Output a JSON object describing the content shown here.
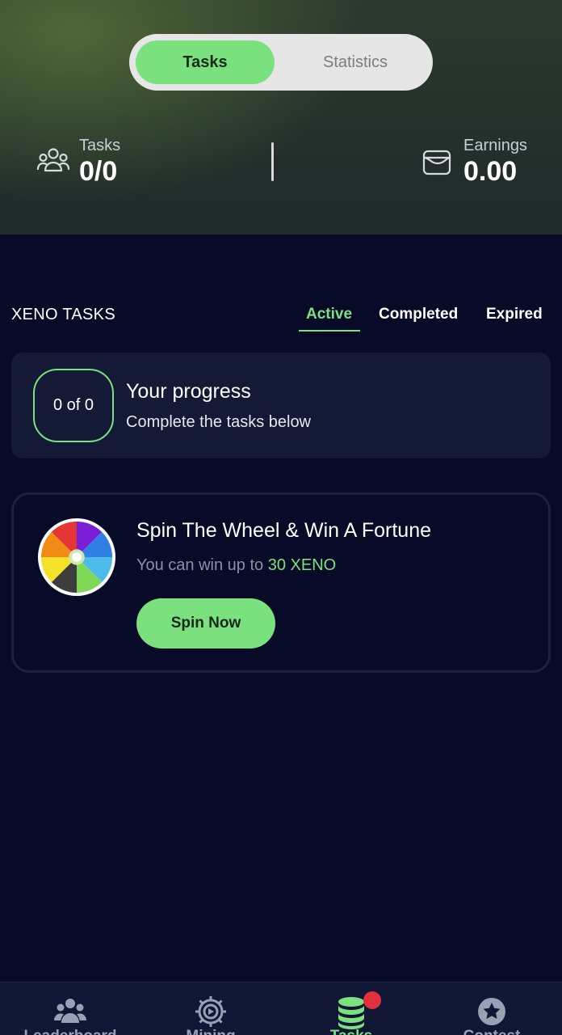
{
  "top_toggle": {
    "tasks_label": "Tasks",
    "statistics_label": "Statistics"
  },
  "stats": {
    "tasks": {
      "label": "Tasks",
      "value": "0/0",
      "icon": "users-group-icon"
    },
    "earnings": {
      "label": "Earnings",
      "value": "0.00",
      "icon": "wallet-icon"
    }
  },
  "tasks_section": {
    "title": "XENO TASKS",
    "filters": [
      "Active",
      "Completed",
      "Expired"
    ],
    "active_filter": "Active"
  },
  "progress": {
    "badge": "0 of 0",
    "title": "Your progress",
    "subtitle": "Complete the tasks below"
  },
  "spin_card": {
    "title": "Spin The Wheel & Win A Fortune",
    "subtitle_prefix": "You can win up to ",
    "subtitle_amount": "30 XENO",
    "button_label": "Spin Now",
    "icon": "prize-wheel-icon"
  },
  "bottom_nav": {
    "items": [
      {
        "label": "Leaderboard",
        "icon": "users-icon"
      },
      {
        "label": "Mining",
        "icon": "gear-play-icon"
      },
      {
        "label": "Tasks",
        "icon": "coin-stack-icon"
      },
      {
        "label": "Contest",
        "icon": "star-badge-icon"
      }
    ],
    "active": "Tasks",
    "notification_color": "#e0313d"
  },
  "colors": {
    "accent": "#7be07e",
    "background": "#070b27",
    "card": "#141a36"
  }
}
